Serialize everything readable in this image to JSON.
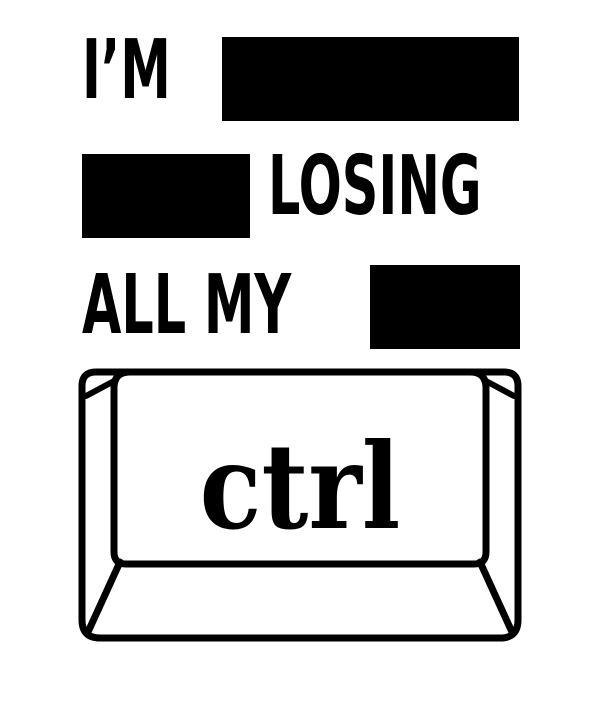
{
  "poster": {
    "line1": "I’M",
    "line2": "LOSING",
    "line3": "ALL MY",
    "key_label": "ctrl"
  },
  "colors": {
    "ink": "#000000",
    "background": "#ffffff"
  },
  "icons": {
    "key": "keyboard-key-icon"
  }
}
